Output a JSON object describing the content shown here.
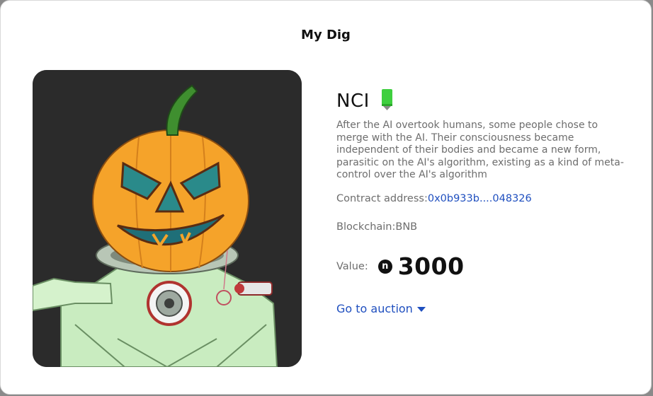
{
  "modal": {
    "title": "My Dig"
  },
  "nft": {
    "name": "NCI",
    "tag_icon": "green-tag-icon",
    "description": "After the AI overtook humans, some people chose to merge with the AI. Their consciousness became independent of their bodies and became a new form, parasitic on the AI's algorithm, existing as a kind of meta-control over the AI's algorithm",
    "contract_label": "Contract address:",
    "contract_value": "0x0b933b....048326",
    "blockchain_text": "Blockchain:BNB",
    "value_label": "Value:",
    "coin_icon": "coin-icon",
    "coin_glyph": "n",
    "value": "3000",
    "auction_label": "Go to auction",
    "auction_icon": "caret-down-icon"
  },
  "colors": {
    "accent_link": "#1f4fbf",
    "tag_green": "#3ecf3e",
    "art_background": "#2b2b2b"
  }
}
